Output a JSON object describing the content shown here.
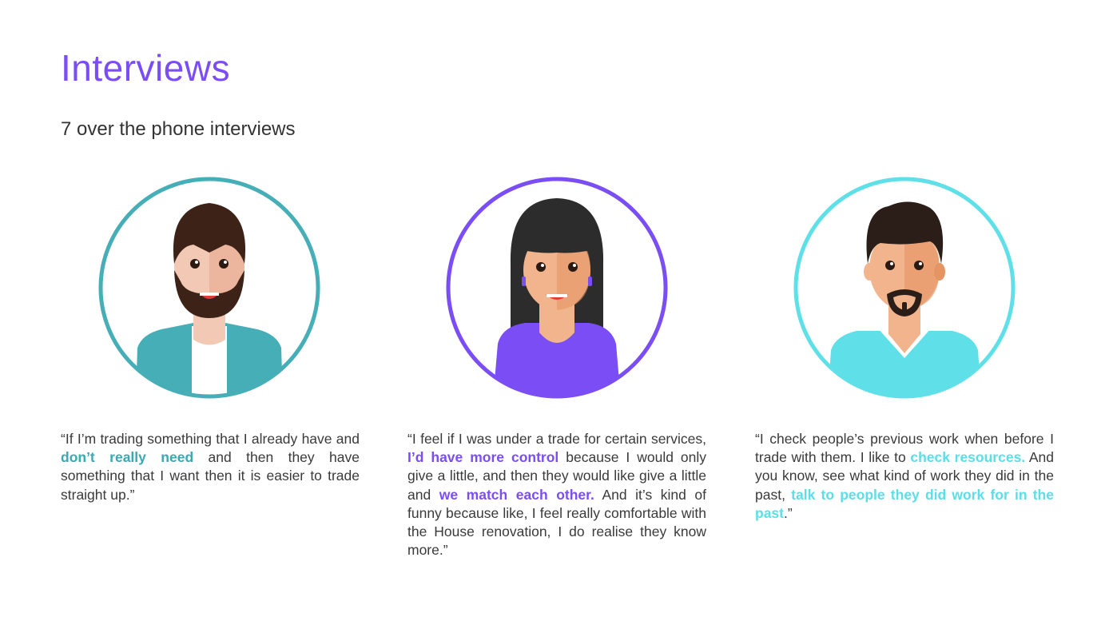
{
  "page": {
    "title": "Interviews",
    "subtitle": "7 over the phone interviews"
  },
  "colors": {
    "accent_purple": "#7a4df5",
    "accent_teal": "#45aeb6",
    "accent_cyan": "#5fe0e8",
    "text": "#3a3a3a"
  },
  "interviews": [
    {
      "avatar_icon": "bearded-man-avatar-icon",
      "ring_color": "#45aeb6",
      "quote": [
        {
          "t": "“If I’m trading something that I already have and "
        },
        {
          "t": "don’t really need",
          "hl": true
        },
        {
          "t": " and then they have something that I want then it is easier to trade straight up.”"
        }
      ]
    },
    {
      "avatar_icon": "woman-avatar-icon",
      "ring_color": "#7a4df5",
      "quote": [
        {
          "t": "“I feel if I was under a trade for certain services, "
        },
        {
          "t": "I’d have more control",
          "hl": true
        },
        {
          "t": " because I would only give a little, and then they would like give a little and "
        },
        {
          "t": "we match each other.",
          "hl": true
        },
        {
          "t": " And it’s kind of funny because like, I feel really comfortable with the House renovation, I do realise they know more.”"
        }
      ]
    },
    {
      "avatar_icon": "goatee-man-avatar-icon",
      "ring_color": "#5fe0e8",
      "quote": [
        {
          "t": "“I check people’s previous work when before I trade with them. I like to "
        },
        {
          "t": "check resources.",
          "hl": true
        },
        {
          "t": " And you know, see what kind of work they did in the past, "
        },
        {
          "t": "talk to people they did work for in the past",
          "hl": true
        },
        {
          "t": ".”"
        }
      ]
    }
  ]
}
